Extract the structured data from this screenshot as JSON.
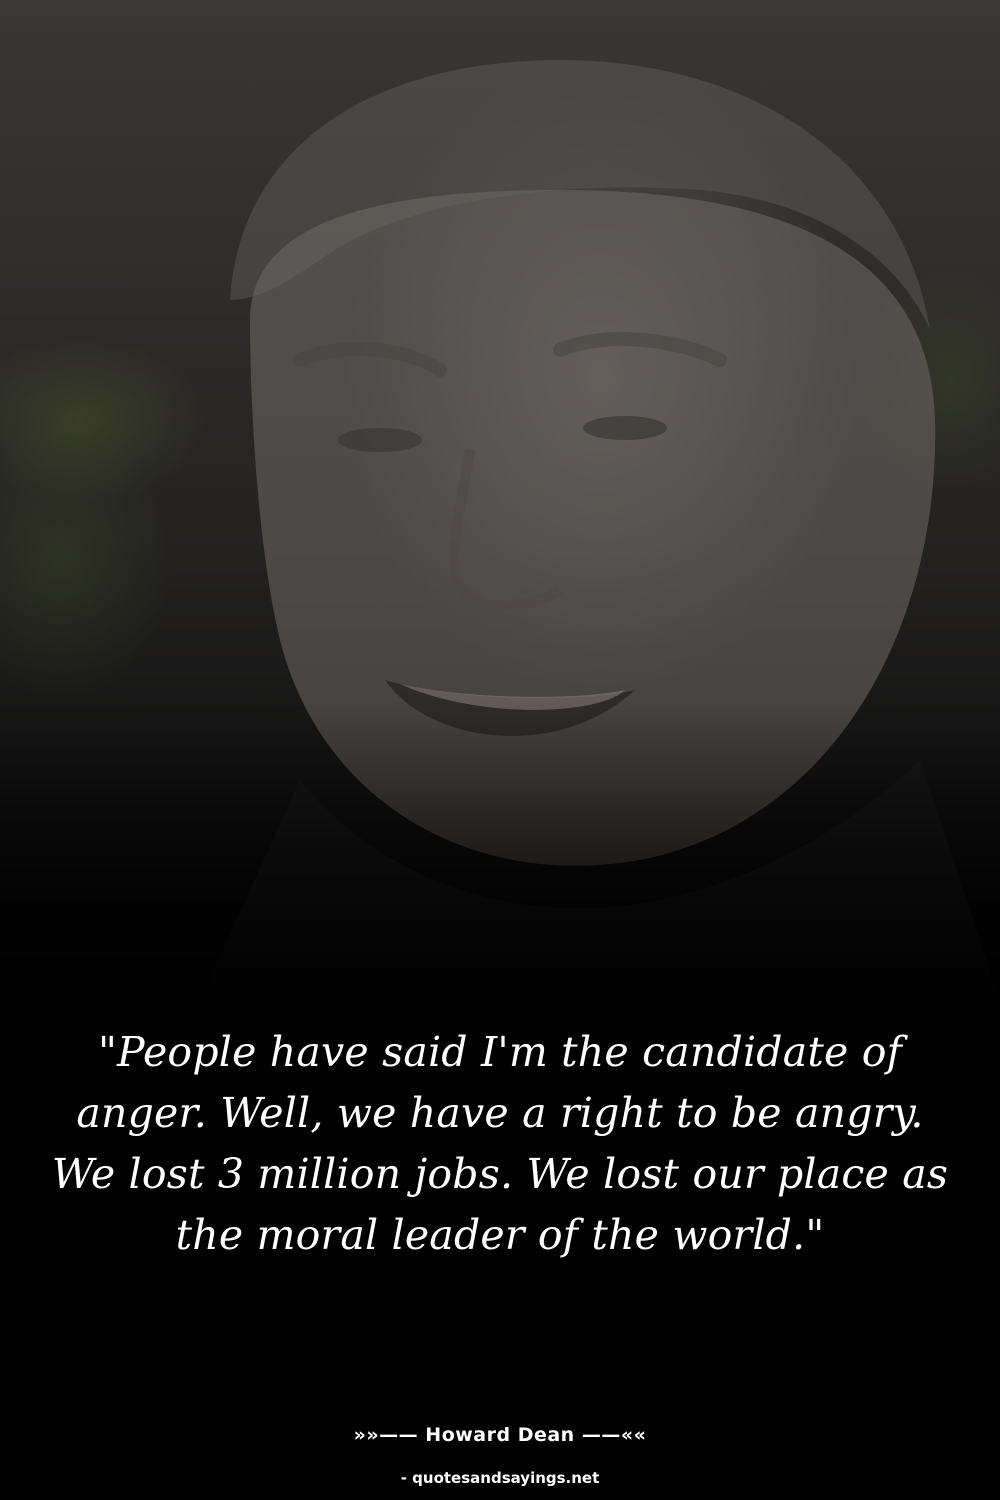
{
  "quote": {
    "text": "\"People have said I'm the candidate of anger. Well, we have a right to be angry. We lost 3 million jobs. We lost our place as the moral leader of the world.\""
  },
  "attribution": {
    "author": "»»—— Howard Dean ——««"
  },
  "source": {
    "site": "- quotesandsayings.net"
  },
  "colors": {
    "background": "#000000",
    "text": "#ffffff"
  }
}
